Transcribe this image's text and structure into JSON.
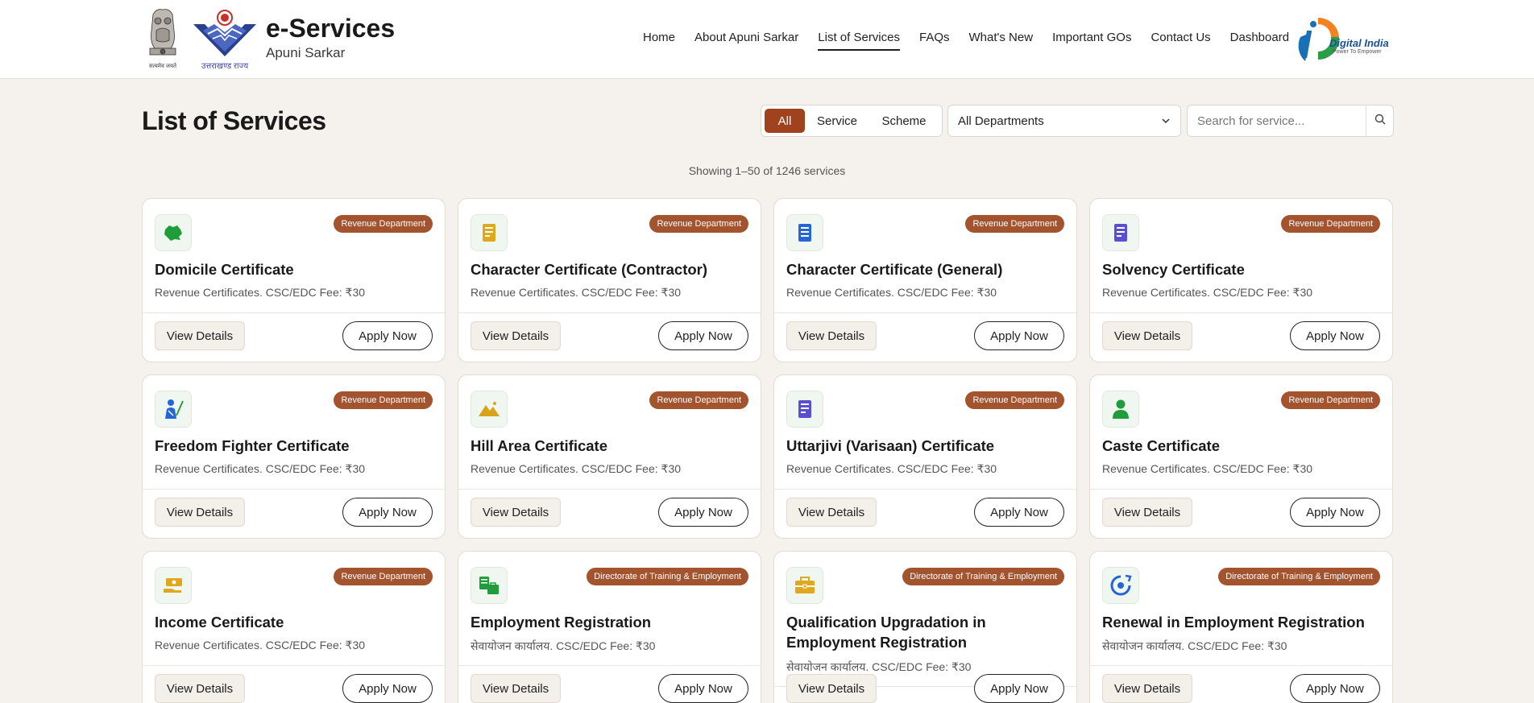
{
  "header": {
    "emblem_caption": "सत्यमेव जयते",
    "state_logo_caption": "उत्तराखण्ड राज्य",
    "title": "e-Services",
    "subtitle": "Apuni Sarkar",
    "nav": [
      {
        "label": "Home"
      },
      {
        "label": "About Apuni Sarkar"
      },
      {
        "label": "List of Services",
        "active": true
      },
      {
        "label": "FAQs"
      },
      {
        "label": "What's New"
      },
      {
        "label": "Important GOs"
      },
      {
        "label": "Contact Us"
      },
      {
        "label": "Dashboard"
      }
    ],
    "digital_india": {
      "title": "Digital India",
      "tagline": "Power To Empower"
    }
  },
  "toolbar": {
    "page_title": "List of Services",
    "segments": [
      "All",
      "Service",
      "Scheme"
    ],
    "active_segment": "All",
    "department_select": "All Departments",
    "search_placeholder": "Search for service..."
  },
  "showing_text": "Showing 1–50 of 1246 services",
  "colors": {
    "accent": "#a0421e",
    "badge": "#a3532e",
    "background": "#f5f1ec"
  },
  "cards": [
    {
      "title": "Domicile Certificate",
      "department": "Revenue Department",
      "desc": "Revenue Certificates. CSC/EDC Fee: ₹30",
      "icon": "uttarakhand-map-icon",
      "view_label": "View Details",
      "apply_label": "Apply Now"
    },
    {
      "title": "Character Certificate (Contractor)",
      "department": "Revenue Department",
      "desc": "Revenue Certificates. CSC/EDC Fee: ₹30",
      "icon": "document-yellow-icon",
      "view_label": "View Details",
      "apply_label": "Apply Now"
    },
    {
      "title": "Character Certificate (General)",
      "department": "Revenue Department",
      "desc": "Revenue Certificates. CSC/EDC Fee: ₹30",
      "icon": "document-blue-icon",
      "view_label": "View Details",
      "apply_label": "Apply Now"
    },
    {
      "title": "Solvency Certificate",
      "department": "Revenue Department",
      "desc": "Revenue Certificates. CSC/EDC Fee: ₹30",
      "icon": "document-purple-icon",
      "view_label": "View Details",
      "apply_label": "Apply Now"
    },
    {
      "title": "Freedom Fighter Certificate",
      "department": "Revenue Department",
      "desc": "Revenue Certificates. CSC/EDC Fee: ₹30",
      "icon": "freedom-fighter-icon",
      "view_label": "View Details",
      "apply_label": "Apply Now"
    },
    {
      "title": "Hill Area Certificate",
      "department": "Revenue Department",
      "desc": "Revenue Certificates. CSC/EDC Fee: ₹30",
      "icon": "mountain-icon",
      "view_label": "View Details",
      "apply_label": "Apply Now"
    },
    {
      "title": "Uttarjivi (Varisaan) Certificate",
      "department": "Revenue Department",
      "desc": "Revenue Certificates. CSC/EDC Fee: ₹30",
      "icon": "document-purple-icon",
      "view_label": "View Details",
      "apply_label": "Apply Now"
    },
    {
      "title": "Caste Certificate",
      "department": "Revenue Department",
      "desc": "Revenue Certificates. CSC/EDC Fee: ₹30",
      "icon": "person-icon",
      "view_label": "View Details",
      "apply_label": "Apply Now"
    },
    {
      "title": "Income Certificate",
      "department": "Revenue Department",
      "desc": "Revenue Certificates. CSC/EDC Fee: ₹30",
      "icon": "money-hand-icon",
      "view_label": "View Details",
      "apply_label": "Apply Now"
    },
    {
      "title": "Employment Registration",
      "department": "Directorate of Training & Employment",
      "desc": "सेवायोजन कार्यालय. CSC/EDC Fee: ₹30",
      "icon": "employment-docs-icon",
      "view_label": "View Details",
      "apply_label": "Apply Now"
    },
    {
      "title": "Qualification Upgradation in Employment Registration",
      "department": "Directorate of Training & Employment",
      "desc": "सेवायोजन कार्यालय. CSC/EDC Fee: ₹30",
      "icon": "briefcase-icon",
      "view_label": "View Details",
      "apply_label": "Apply Now"
    },
    {
      "title": "Renewal in Employment Registration",
      "department": "Directorate of Training & Employment",
      "desc": "सेवायोजन कार्यालय. CSC/EDC Fee: ₹30",
      "icon": "renewal-icon",
      "view_label": "View Details",
      "apply_label": "Apply Now"
    }
  ]
}
